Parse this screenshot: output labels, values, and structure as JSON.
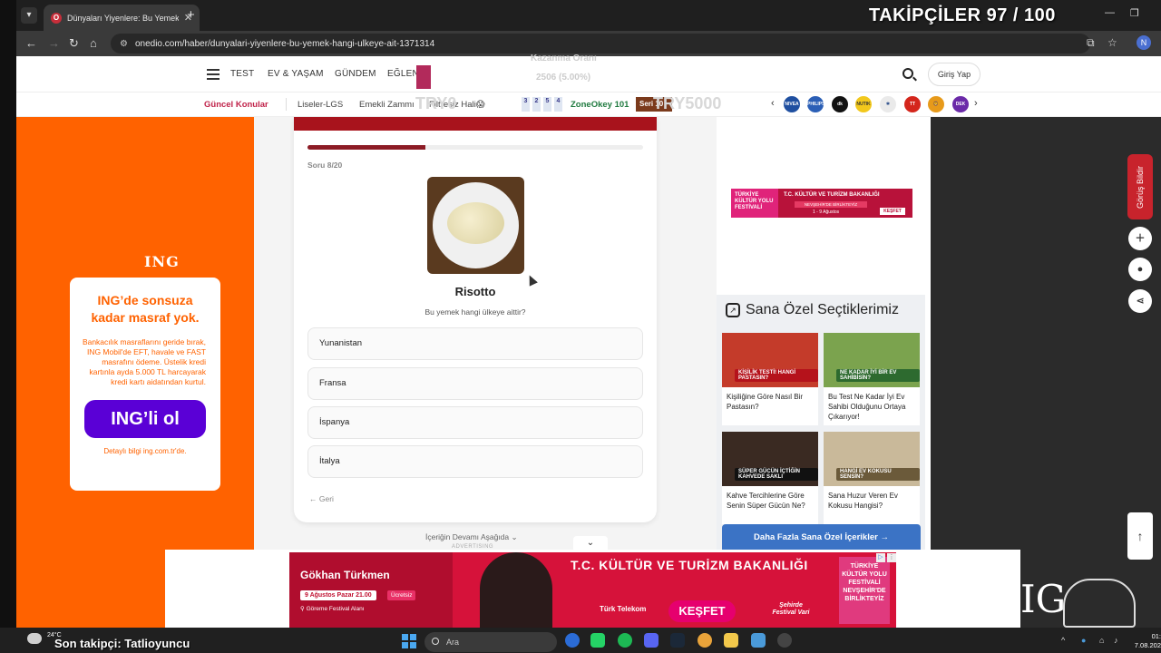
{
  "browser": {
    "tab_title": "Dünyaları Yiyenlere: Bu Yemek Hangi Ülkeye Ait?",
    "tab_favicon": "O",
    "url": "onedio.com/haber/dunyalari-yiyenlere-bu-yemek-hangi-ulkeye-ait-1371314",
    "profile_initial": "N"
  },
  "stream_overlay": {
    "followers": "TAKİPÇİLER 97 / 100",
    "last_follower": "Son takipçi: Tatlioyuncu"
  },
  "site_header": {
    "nav": [
      "TEST",
      "EV & YAŞAM",
      "GÜNDEM",
      "EĞLEN"
    ],
    "ghost_line1": "Kazanma Oranı",
    "ghost_line2": "2506 (5.00%)",
    "login_label": "Giriş Yap"
  },
  "topics": {
    "current_label": "Güncel Konular",
    "items": [
      "Liseler-LGS",
      "Emekli Zammı",
      "Filtresiz Hali😱"
    ],
    "ghost_try": "TRY0",
    "ghost_try2": "TRY5000",
    "numbers": [
      "3",
      "2",
      "5",
      "4"
    ],
    "zone": "ZoneOkey 101",
    "seri": "Seri 10"
  },
  "brand_logos": [
    "NIVEA",
    "PHILIPS",
    "dk",
    "NUTIK",
    "✱",
    "TT",
    "🦁",
    "DEK"
  ],
  "left_ad": {
    "logo": "ING",
    "title": "ING’de sonsuza kadar masraf yok.",
    "desc": "Bankacılık masraflarını geride bırak, ING Mobil'de EFT, havale ve FAST masrafını ödeme. Üstelik kredi kartınla ayda 5.000 TL harcayarak kredi kartı aidatından kurtul.",
    "cta": "ING’li ol",
    "note": "Detaylı bilgi ing.com.tr'de."
  },
  "quiz": {
    "progress": 0.35,
    "question_count": "Soru 8/20",
    "food_name": "Risotto",
    "question": "Bu yemek hangi ülkeye aittir?",
    "options": [
      "Yunanistan",
      "Fransa",
      "İspanya",
      "İtalya"
    ],
    "back_label": "← Geri",
    "continue_hint": "İçeriğin Devamı Aşağıda",
    "adv_label": "ADVERTISING"
  },
  "right_banner": {
    "festival_left": "TÜRKİYE KÜLTÜR YOLU FESTİVALİ",
    "ministry": "T.C. KÜLTÜR VE TURİZM BAKANLIĞI",
    "slogan": "NEVŞEHİR'DE BİRLİKTEYİZ",
    "dates": "1 - 9 Ağustos",
    "cta": "KEŞFET"
  },
  "recommendations": {
    "title": "Sana Özel Seçtiklerimiz",
    "items": [
      {
        "badge": "KİŞİLİK TESTİ! HANGİ PASTASIN?",
        "text": "Kişiliğine Göre Nasıl Bir Pastasın?",
        "color": "#c43b2a"
      },
      {
        "badge": "NE KADAR İYİ BİR EV SAHİBİSİN?",
        "text": "Bu Test Ne Kadar İyi Ev Sahibi Olduğunu Ortaya Çıkarıyor!",
        "color": "#7ba34e"
      },
      {
        "badge": "SÜPER GÜCÜN İÇTİĞİN KAHVEDE SAKLI",
        "text": "Kahve Tercihlerine Göre Senin Süper Gücün Ne?",
        "color": "#3a2a22"
      },
      {
        "badge": "HANGİ EV KOKUSU SENSİN?",
        "text": "Sana Huzur Veren Ev Kokusu Hangisi?",
        "color": "#c9b99a"
      }
    ],
    "more_label": "Daha Fazla Sana Özel İçerikler →"
  },
  "side_actions": {
    "feedback_label": "Görüş Bildir",
    "scroll_top": "↑"
  },
  "bottom_ad": {
    "artist": "Gökhan Türkmen",
    "date": "9 Ağustos Pazar 21.00",
    "free": "Ücretsiz",
    "location": "Göreme Festival Alanı",
    "ministry": "T.C. KÜLTÜR VE TURİZM BAKANLIĞI",
    "sponsor": "Türk Telekom",
    "cta": "KEŞFET",
    "tagline": "Şehirde Festival Vari",
    "festival": "TÜRKİYE KÜLTÜR YOLU FESTİVALİ NEVŞEHİR'DE BİRLİKTEYİZ",
    "ing_text": "IG"
  },
  "taskbar": {
    "weather": "24°C",
    "search_placeholder": "Ara",
    "time": "01:",
    "date": "7.08.202"
  }
}
